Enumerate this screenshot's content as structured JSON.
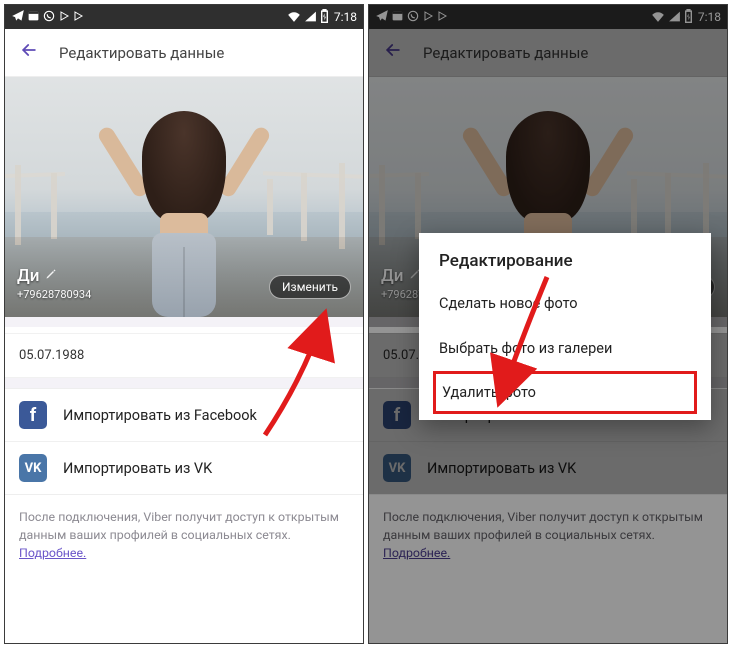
{
  "status": {
    "time": "7:18",
    "icons_left": [
      "telegram",
      "calendar",
      "viber",
      "play",
      "play"
    ],
    "icons_right": [
      "wifi",
      "signal",
      "battery"
    ]
  },
  "appbar": {
    "title": "Редактировать данные"
  },
  "profile": {
    "name": "Ди",
    "phone": "+79628780934",
    "change_button": "Изменить",
    "dob": "05.07.1988"
  },
  "imports": {
    "facebook": "Импортировать из Facebook",
    "vk": "Импортировать из VK"
  },
  "footer": {
    "text": "После подключения, Viber получит доступ к открытым данным ваших профилей в социальных сетях.",
    "link": "Подробнее."
  },
  "dialog": {
    "title": "Редактирование",
    "opt_new": "Сделать новое фото",
    "opt_gallery": "Выбрать фото из галереи",
    "opt_delete": "Удалить фото"
  },
  "right_change_partial": "енить"
}
